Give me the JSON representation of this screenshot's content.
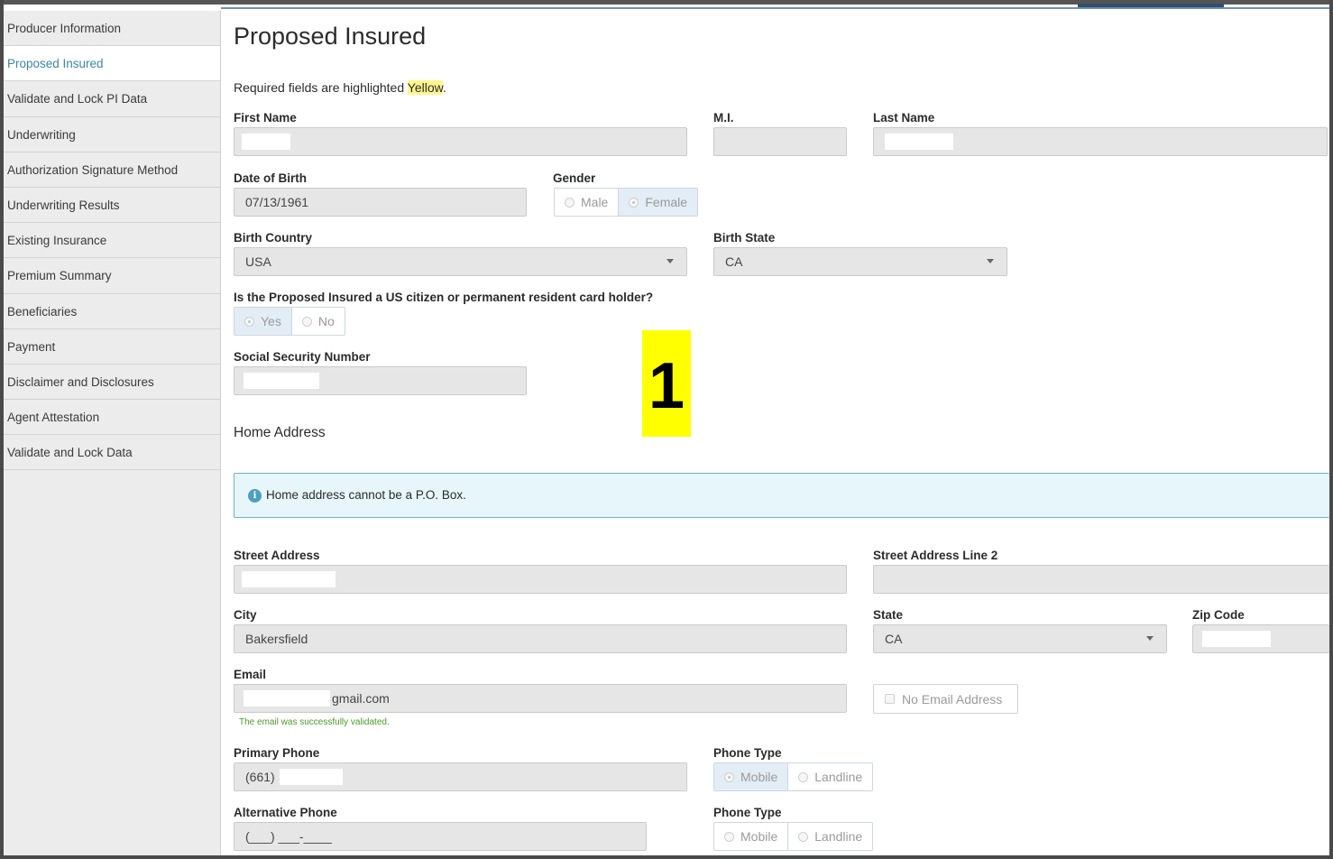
{
  "sidebar": {
    "items": [
      {
        "label": "Producer Information",
        "active": false
      },
      {
        "label": "Proposed Insured",
        "active": true
      },
      {
        "label": "Validate and Lock PI Data",
        "active": false
      },
      {
        "label": "Underwriting",
        "active": false
      },
      {
        "label": "Authorization Signature Method",
        "active": false
      },
      {
        "label": "Underwriting Results",
        "active": false
      },
      {
        "label": "Existing Insurance",
        "active": false
      },
      {
        "label": "Premium Summary",
        "active": false
      },
      {
        "label": "Beneficiaries",
        "active": false
      },
      {
        "label": "Payment",
        "active": false
      },
      {
        "label": "Disclaimer and Disclosures",
        "active": false
      },
      {
        "label": "Agent Attestation",
        "active": false
      },
      {
        "label": "Validate and Lock Data",
        "active": false
      }
    ]
  },
  "main": {
    "title": "Proposed Insured",
    "required_note_prefix": "Required fields are highlighted ",
    "required_note_highlight": "Yellow",
    "required_note_suffix": ".",
    "first_name": {
      "label": "First Name",
      "value": ""
    },
    "mi": {
      "label": "M.I.",
      "value": ""
    },
    "last_name": {
      "label": "Last Name",
      "value": ""
    },
    "dob": {
      "label": "Date of Birth",
      "value": "07/13/1961"
    },
    "gender": {
      "label": "Gender",
      "options": [
        "Male",
        "Female"
      ],
      "selected": "Female"
    },
    "birth_country": {
      "label": "Birth Country",
      "value": "USA"
    },
    "birth_state": {
      "label": "Birth State",
      "value": "CA"
    },
    "citizen": {
      "label": "Is the Proposed Insured a US citizen or permanent resident card holder?",
      "options": [
        "Yes",
        "No"
      ],
      "selected": "Yes"
    },
    "ssn": {
      "label": "Social Security Number",
      "value": ""
    },
    "marker": "1",
    "home_address_title": "Home Address",
    "info_icon": "info-icon",
    "info_text": "Home address cannot be a P.O. Box.",
    "street": {
      "label": "Street Address",
      "value": ""
    },
    "street2": {
      "label": "Street Address Line 2",
      "value": ""
    },
    "city": {
      "label": "City",
      "value": "Bakersfield"
    },
    "state": {
      "label": "State",
      "value": "CA"
    },
    "zip": {
      "label": "Zip Code",
      "value": ""
    },
    "email": {
      "label": "Email",
      "value": "gmail.com",
      "validation": "The email was successfully validated."
    },
    "no_email": {
      "label": "No Email Address"
    },
    "primary_phone": {
      "label": "Primary Phone",
      "value": "(661)"
    },
    "phone_type_1": {
      "label": "Phone Type",
      "options": [
        "Mobile",
        "Landline"
      ],
      "selected": "Mobile"
    },
    "alt_phone": {
      "label": "Alternative Phone",
      "value": "(___) ___-____"
    },
    "phone_type_2": {
      "label": "Phone Type",
      "options": [
        "Mobile",
        "Landline"
      ],
      "selected": ""
    }
  }
}
